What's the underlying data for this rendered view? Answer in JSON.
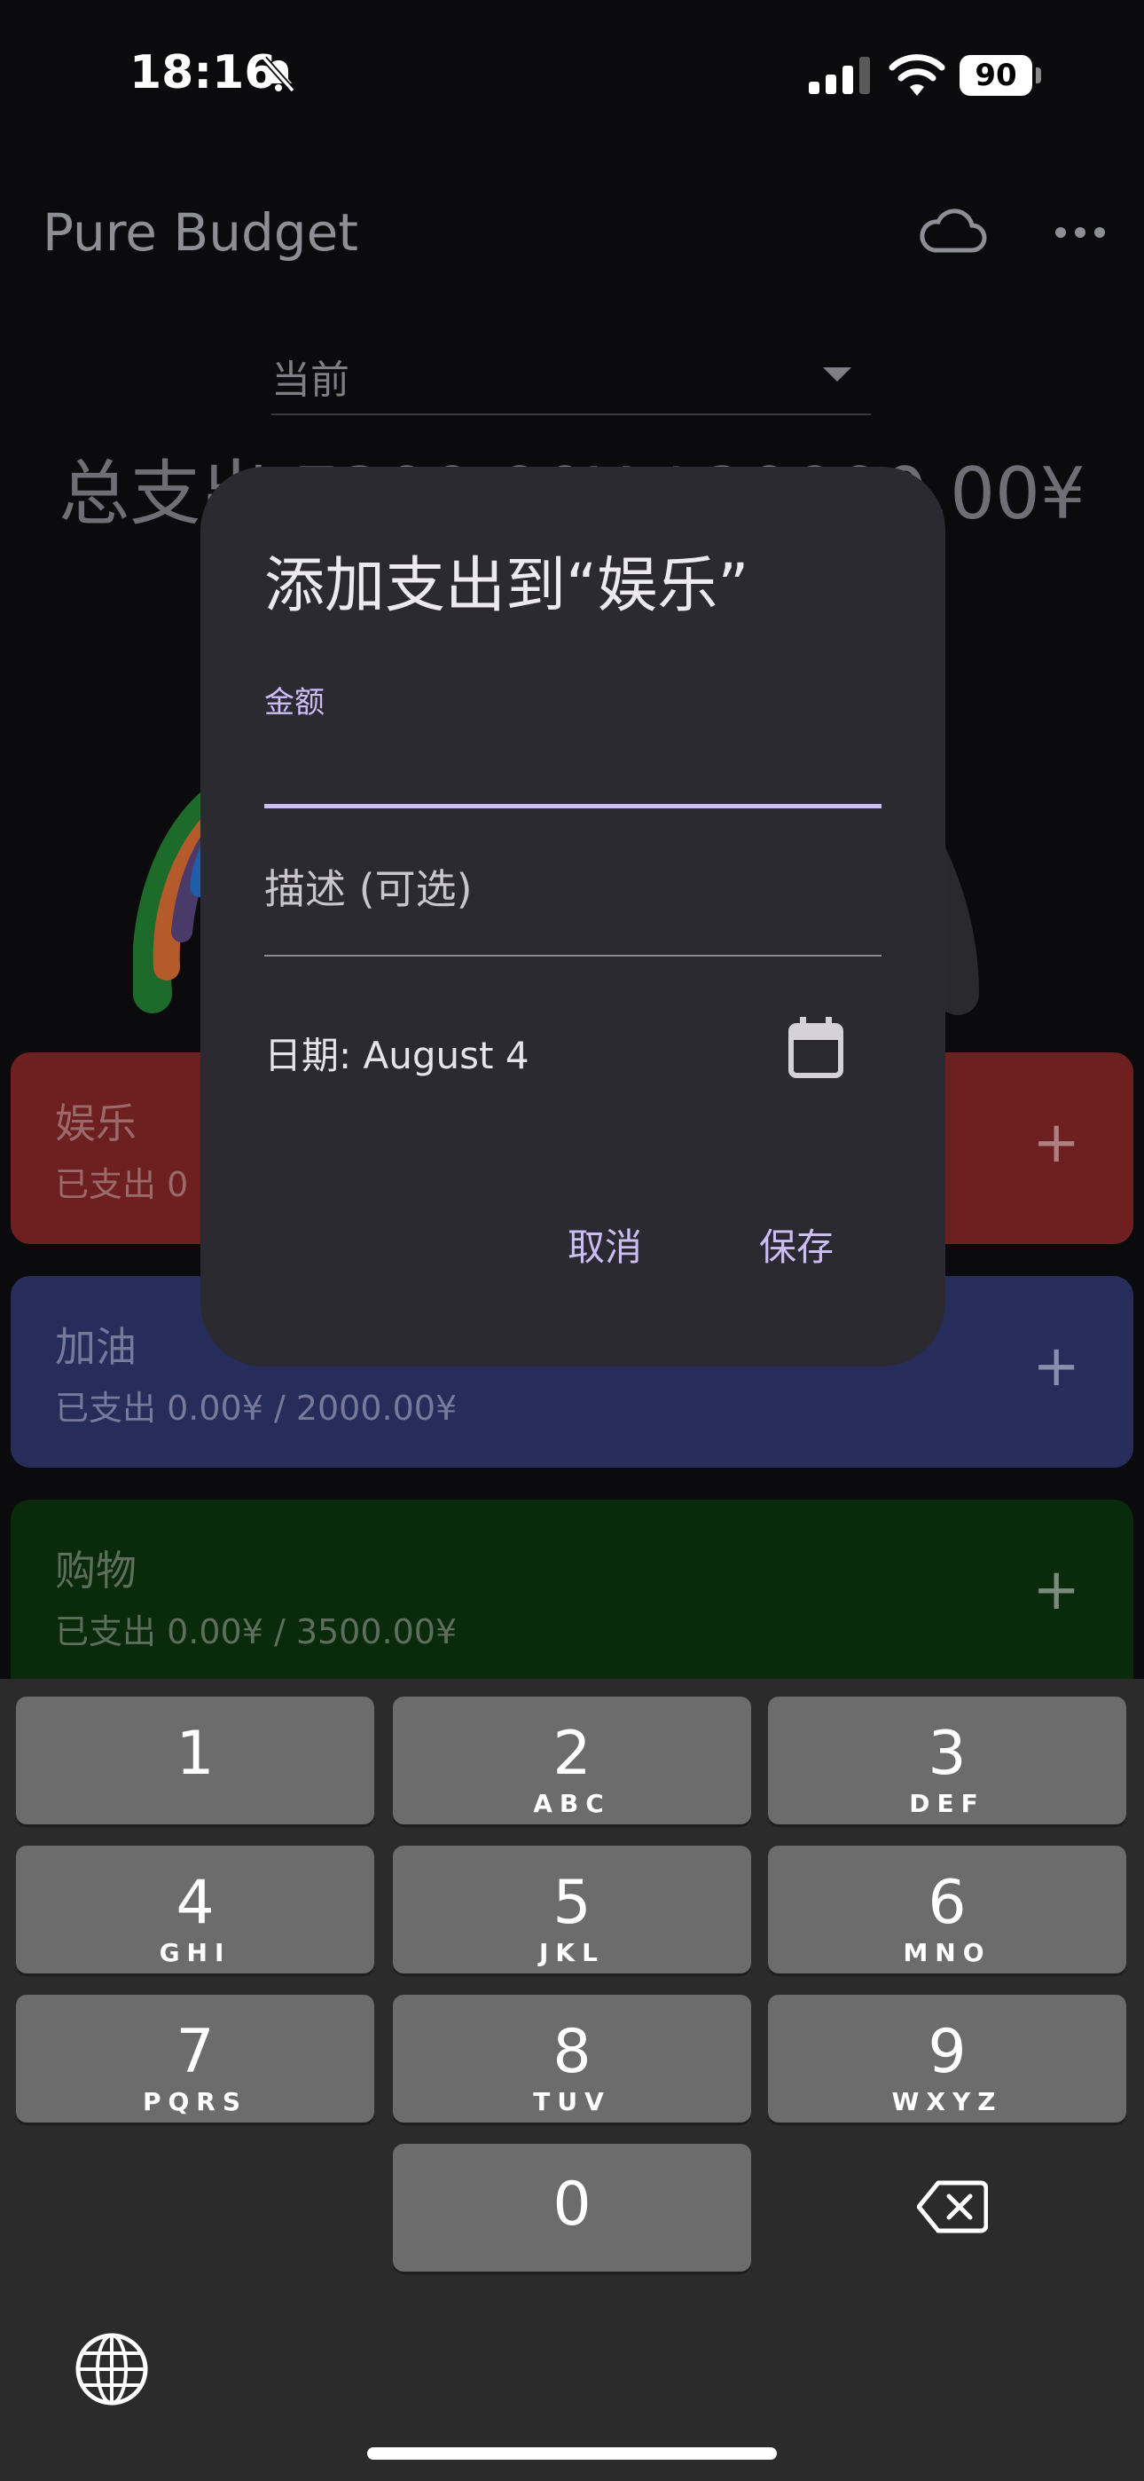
{
  "status_bar": {
    "time": "18:16",
    "battery": "90"
  },
  "app": {
    "title": "Pure Budget"
  },
  "period_selector": {
    "value": "当前"
  },
  "summary": {
    "total": "总支出 7200.00¥ / 20000.00¥"
  },
  "categories": [
    {
      "name": "娱乐",
      "spent": "已支出 0",
      "color": "#6e1f1f"
    },
    {
      "name": "加油",
      "spent": "已支出 0.00¥ / 2000.00¥",
      "color": "#262d5a"
    },
    {
      "name": "购物",
      "spent": "已支出 0.00¥ / 3500.00¥",
      "color": "#0a2a0c"
    }
  ],
  "add_symbol": "+",
  "dialog": {
    "title": "添加支出到“娱乐”",
    "amount_label": "金额",
    "description_placeholder": "描述 (可选)",
    "date_text": "日期: August 4",
    "cancel": "取消",
    "save": "保存"
  },
  "keypad": {
    "keys": [
      {
        "num": "1",
        "letters": ""
      },
      {
        "num": "2",
        "letters": "ABC"
      },
      {
        "num": "3",
        "letters": "DEF"
      },
      {
        "num": "4",
        "letters": "GHI"
      },
      {
        "num": "5",
        "letters": "JKL"
      },
      {
        "num": "6",
        "letters": "MNO"
      },
      {
        "num": "7",
        "letters": "PQRS"
      },
      {
        "num": "8",
        "letters": "TUV"
      },
      {
        "num": "9",
        "letters": "WXYZ"
      },
      {
        "num": "0",
        "letters": ""
      }
    ]
  },
  "icons": [
    "bell-slash-icon",
    "signal-icon",
    "wifi-icon",
    "battery-icon",
    "cloud-icon",
    "more-icon",
    "calendar-icon",
    "backspace-icon",
    "globe-icon"
  ]
}
